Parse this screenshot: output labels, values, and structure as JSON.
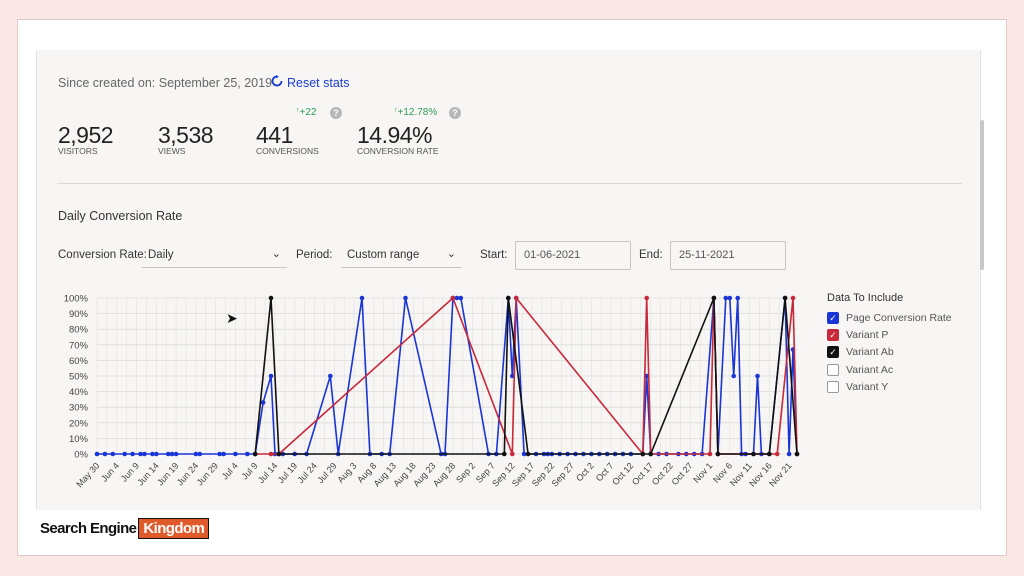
{
  "header": {
    "since_text": "Since created on: September 25, 2019",
    "reset_label": "Reset stats"
  },
  "stats": [
    {
      "value": "2,952",
      "label": "VISITORS"
    },
    {
      "value": "3,538",
      "label": "VIEWS"
    },
    {
      "value": "441",
      "label": "CONVERSIONS",
      "delta": "+22"
    },
    {
      "value": "14.94%",
      "label": "CONVERSION RATE",
      "delta": "+12.78%"
    }
  ],
  "help_glyph": "?",
  "section_title": "Daily Conversion Rate",
  "controls": {
    "rate_label": "Conversion Rate:",
    "rate_value": "Daily",
    "period_label": "Period:",
    "period_value": "Custom range",
    "start_label": "Start:",
    "start_value": "01-06-2021",
    "end_label": "End:",
    "end_value": "25-11-2021"
  },
  "legend": {
    "title": "Data To Include",
    "items": [
      {
        "label": "Page Conversion Rate",
        "checked": true,
        "color": "#1a35d6"
      },
      {
        "label": "Variant P",
        "checked": true,
        "color": "#c8283a"
      },
      {
        "label": "Variant Ab",
        "checked": true,
        "color": "#111111"
      },
      {
        "label": "Variant Ac",
        "checked": false,
        "color": "#999999"
      },
      {
        "label": "Variant Y",
        "checked": false,
        "color": "#999999"
      }
    ]
  },
  "logo": {
    "text_a": "Search Engine",
    "text_b": "Kingdom"
  },
  "chart_data": {
    "type": "line",
    "x_start": "May 30",
    "x_end": "Nov 23",
    "x_tick_labels": [
      "May 30",
      "Jun 4",
      "Jun 9",
      "Jun 14",
      "Jun 19",
      "Jun 24",
      "Jun 29",
      "Jul 4",
      "Jul 9",
      "Jul 14",
      "Jul 19",
      "Jul 24",
      "Jul 29",
      "Aug 3",
      "Aug 8",
      "Aug 13",
      "Aug 18",
      "Aug 23",
      "Aug 28",
      "Sep 2",
      "Sep 7",
      "Sep 12",
      "Sep 17",
      "Sep 22",
      "Sep 27",
      "Oct 2",
      "Oct 7",
      "Oct 12",
      "Oct 17",
      "Oct 22",
      "Oct 27",
      "Nov 1",
      "Nov 6",
      "Nov 11",
      "Nov 16",
      "Nov 21"
    ],
    "y_ticks": [
      "0%",
      "10%",
      "20%",
      "30%",
      "40%",
      "50%",
      "60%",
      "70%",
      "80%",
      "90%",
      "100%"
    ],
    "ylim": [
      0,
      100
    ],
    "grid": true,
    "legend_position": "right",
    "series": [
      {
        "name": "Page Conversion Rate",
        "color": "#1a35d6",
        "points": [
          [
            "May 30",
            0
          ],
          [
            "Jun 1",
            0
          ],
          [
            "Jun 3",
            0
          ],
          [
            "Jun 6",
            0
          ],
          [
            "Jun 8",
            0
          ],
          [
            "Jun 10",
            0
          ],
          [
            "Jun 11",
            0
          ],
          [
            "Jun 13",
            0
          ],
          [
            "Jun 14",
            0
          ],
          [
            "Jun 17",
            0
          ],
          [
            "Jun 18",
            0
          ],
          [
            "Jun 19",
            0
          ],
          [
            "Jun 24",
            0
          ],
          [
            "Jun 25",
            0
          ],
          [
            "Jun 30",
            0
          ],
          [
            "Jul 1",
            0
          ],
          [
            "Jul 4",
            0
          ],
          [
            "Jul 7",
            0
          ],
          [
            "Jul 9",
            0
          ],
          [
            "Jul 11",
            33
          ],
          [
            "Jul 13",
            50
          ],
          [
            "Jul 14",
            0
          ],
          [
            "Jul 15",
            0
          ],
          [
            "Jul 16",
            0
          ],
          [
            "Jul 19",
            0
          ],
          [
            "Jul 22",
            0
          ],
          [
            "Jul 28",
            50
          ],
          [
            "Jul 30",
            0
          ],
          [
            "Aug 5",
            100
          ],
          [
            "Aug 7",
            0
          ],
          [
            "Aug 10",
            0
          ],
          [
            "Aug 12",
            0
          ],
          [
            "Aug 16",
            100
          ],
          [
            "Aug 25",
            0
          ],
          [
            "Aug 26",
            0
          ],
          [
            "Aug 28",
            100
          ],
          [
            "Aug 29",
            100
          ],
          [
            "Aug 30",
            100
          ],
          [
            "Sep 6",
            0
          ],
          [
            "Sep 8",
            0
          ],
          [
            "Sep 11",
            100
          ],
          [
            "Sep 12",
            50
          ],
          [
            "Sep 13",
            100
          ],
          [
            "Sep 15",
            0
          ],
          [
            "Sep 18",
            0
          ],
          [
            "Sep 20",
            0
          ],
          [
            "Sep 21",
            0
          ],
          [
            "Sep 22",
            0
          ],
          [
            "Sep 24",
            0
          ],
          [
            "Sep 26",
            0
          ],
          [
            "Sep 28",
            0
          ],
          [
            "Sep 30",
            0
          ],
          [
            "Oct 2",
            0
          ],
          [
            "Oct 4",
            0
          ],
          [
            "Oct 6",
            0
          ],
          [
            "Oct 8",
            0
          ],
          [
            "Oct 10",
            0
          ],
          [
            "Oct 12",
            0
          ],
          [
            "Oct 15",
            0
          ],
          [
            "Oct 16",
            50
          ],
          [
            "Oct 17",
            0
          ],
          [
            "Oct 19",
            0
          ],
          [
            "Oct 21",
            0
          ],
          [
            "Oct 24",
            0
          ],
          [
            "Oct 26",
            0
          ],
          [
            "Oct 28",
            0
          ],
          [
            "Oct 30",
            0
          ],
          [
            "Nov 2",
            100
          ],
          [
            "Nov 3",
            0
          ],
          [
            "Nov 5",
            100
          ],
          [
            "Nov 6",
            100
          ],
          [
            "Nov 7",
            50
          ],
          [
            "Nov 8",
            100
          ],
          [
            "Nov 9",
            0
          ],
          [
            "Nov 10",
            0
          ],
          [
            "Nov 12",
            0
          ],
          [
            "Nov 13",
            50
          ],
          [
            "Nov 14",
            0
          ],
          [
            "Nov 16",
            0
          ],
          [
            "Nov 20",
            100
          ],
          [
            "Nov 21",
            0
          ],
          [
            "Nov 22",
            67
          ],
          [
            "Nov 23",
            0
          ]
        ]
      },
      {
        "name": "Variant P",
        "color": "#c8283a",
        "points": [
          [
            "Jul 9",
            0
          ],
          [
            "Jul 13",
            0
          ],
          [
            "Jul 15",
            0
          ],
          [
            "Aug 28",
            100
          ],
          [
            "Sep 12",
            0
          ],
          [
            "Sep 13",
            100
          ],
          [
            "Oct 15",
            0
          ],
          [
            "Oct 16",
            100
          ],
          [
            "Oct 17",
            0
          ],
          [
            "Nov 1",
            0
          ],
          [
            "Nov 2",
            100
          ],
          [
            "Nov 3",
            0
          ],
          [
            "Nov 18",
            0
          ],
          [
            "Nov 22",
            100
          ],
          [
            "Nov 23",
            0
          ]
        ]
      },
      {
        "name": "Variant Ab",
        "color": "#111111",
        "points": [
          [
            "Jul 9",
            0
          ],
          [
            "Jul 13",
            100
          ],
          [
            "Jul 15",
            0
          ],
          [
            "Sep 10",
            0
          ],
          [
            "Sep 11",
            100
          ],
          [
            "Sep 16",
            0
          ],
          [
            "Oct 15",
            0
          ],
          [
            "Oct 17",
            0
          ],
          [
            "Nov 2",
            100
          ],
          [
            "Nov 3",
            0
          ],
          [
            "Nov 12",
            0
          ],
          [
            "Nov 16",
            0
          ],
          [
            "Nov 20",
            100
          ],
          [
            "Nov 23",
            0
          ]
        ]
      }
    ]
  }
}
